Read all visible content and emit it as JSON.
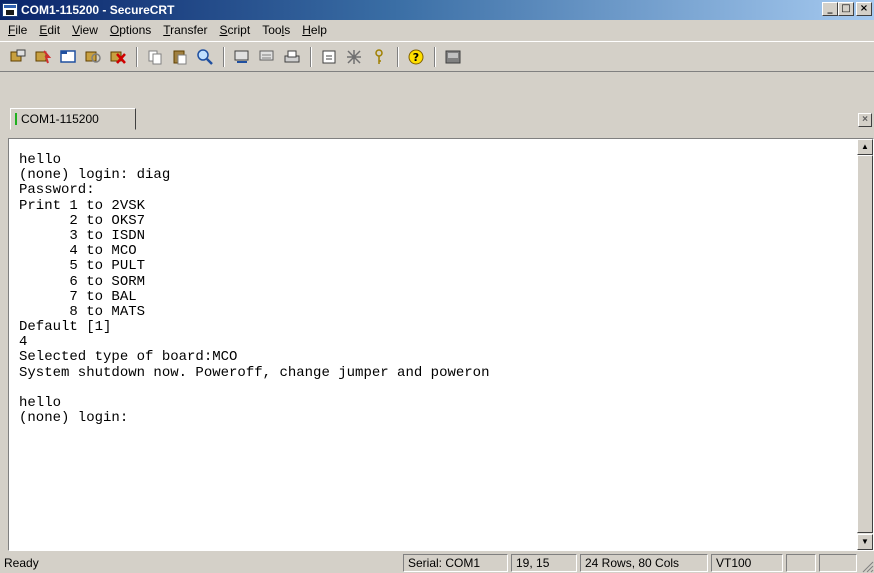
{
  "window": {
    "title": "COM1-115200 - SecureCRT"
  },
  "title_controls": {
    "minimize": "_",
    "maximize": "□",
    "close": "×"
  },
  "menu": [
    {
      "pre": "",
      "u": "F",
      "post": "ile"
    },
    {
      "pre": "",
      "u": "E",
      "post": "dit"
    },
    {
      "pre": "",
      "u": "V",
      "post": "iew"
    },
    {
      "pre": "",
      "u": "O",
      "post": "ptions"
    },
    {
      "pre": "",
      "u": "T",
      "post": "ransfer"
    },
    {
      "pre": "",
      "u": "S",
      "post": "cript"
    },
    {
      "pre": "Too",
      "u": "l",
      "post": "s"
    },
    {
      "pre": "",
      "u": "H",
      "post": "elp"
    }
  ],
  "toolbar_icons": [
    "connect-icon",
    "quick-connect-icon",
    "connect-tab-icon",
    "reconnect-icon",
    "disconnect-icon",
    "copy-icon",
    "paste-icon",
    "find-icon",
    "print-icon",
    "print-selection-icon",
    "print-setup-icon",
    "session-options-icon",
    "global-options-icon",
    "key-map-icon",
    "help-icon",
    "sftp-icon"
  ],
  "tab": {
    "label": "COM1-115200",
    "close": "×"
  },
  "terminal": {
    "lines": [
      "hello",
      "(none) login: diag",
      "Password:",
      "Print 1 to 2VSK",
      "      2 to OKS7",
      "      3 to ISDN",
      "      4 to MCO",
      "      5 to PULT",
      "      6 to SORM",
      "      7 to BAL",
      "      8 to MATS",
      "Default [1]",
      "4",
      "Selected type of board:MCO",
      "System shutdown now. Poweroff, change jumper and poweron",
      "",
      "hello",
      "(none) login:"
    ]
  },
  "scrollbar": {
    "up": "▲",
    "down": "▼"
  },
  "status": {
    "ready": "Ready",
    "serial": "Serial: COM1",
    "cursor": "19, 15",
    "size": "24 Rows, 80 Cols",
    "emulation": "VT100",
    "extra1": "",
    "extra2": ""
  },
  "colors": {
    "titlebar_start": "#0a246a",
    "titlebar_end": "#a6caf0",
    "chrome": "#d4d0c8",
    "tab_mark": "#20b020"
  }
}
